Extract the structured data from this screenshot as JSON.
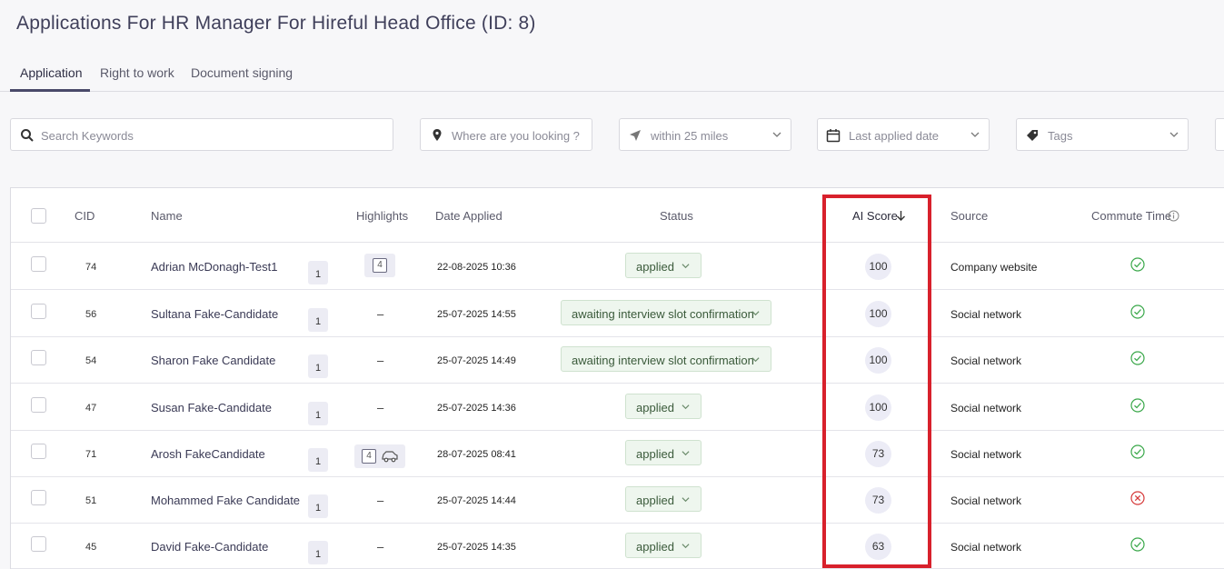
{
  "page": {
    "title": "Applications For HR Manager For Hireful Head Office (ID: 8)"
  },
  "tabs": [
    {
      "label": "Application",
      "active": true
    },
    {
      "label": "Right to work",
      "active": false
    },
    {
      "label": "Document signing",
      "active": false
    }
  ],
  "filters": {
    "keywords_placeholder": "Search Keywords",
    "location_placeholder": "Where are you looking ?",
    "radius": "within 25 miles",
    "date": "Last applied date",
    "tags": "Tags"
  },
  "table": {
    "headers": {
      "cid": "CID",
      "name": "Name",
      "highlights": "Highlights",
      "date": "Date Applied",
      "status": "Status",
      "ai_score": "AI Score",
      "source": "Source",
      "commute": "Commute Time"
    },
    "rows": [
      {
        "cid": "74",
        "name": "Adrian McDonagh-Test1",
        "count": "1",
        "highlight": "4",
        "highlight_icon": "document-icon",
        "date": "22-08-2025 10:36",
        "status": "applied",
        "score": "100",
        "source": "Company website",
        "commute": "ok"
      },
      {
        "cid": "56",
        "name": "Sultana Fake-Candidate",
        "count": "1",
        "highlight": "–",
        "date": "25-07-2025 14:55",
        "status": "awaiting interview slot confirmation",
        "score": "100",
        "source": "Social network",
        "commute": "ok"
      },
      {
        "cid": "54",
        "name": "Sharon Fake Candidate",
        "count": "1",
        "highlight": "–",
        "date": "25-07-2025 14:49",
        "status": "awaiting interview slot confirmation",
        "score": "100",
        "source": "Social network",
        "commute": "ok"
      },
      {
        "cid": "47",
        "name": "Susan Fake-Candidate",
        "count": "1",
        "highlight": "–",
        "date": "25-07-2025 14:36",
        "status": "applied",
        "score": "100",
        "source": "Social network",
        "commute": "ok"
      },
      {
        "cid": "71",
        "name": "Arosh FakeCandidate",
        "count": "1",
        "highlight": "4",
        "highlight_icon": "car-icon",
        "date": "28-07-2025 08:41",
        "status": "applied",
        "score": "73",
        "source": "Social network",
        "commute": "ok"
      },
      {
        "cid": "51",
        "name": "Mohammed Fake Candidate",
        "count": "1",
        "highlight": "–",
        "date": "25-07-2025 14:44",
        "status": "applied",
        "score": "73",
        "source": "Social network",
        "commute": "fail"
      },
      {
        "cid": "45",
        "name": "David Fake-Candidate",
        "count": "1",
        "highlight": "–",
        "date": "25-07-2025 14:35",
        "status": "applied",
        "score": "63",
        "source": "Social network",
        "commute": "ok"
      }
    ]
  },
  "colors": {
    "accent": "#4a4a6a",
    "highlight_frame": "#d8212c",
    "ok": "#3aa84a",
    "fail": "#d63a3a"
  }
}
